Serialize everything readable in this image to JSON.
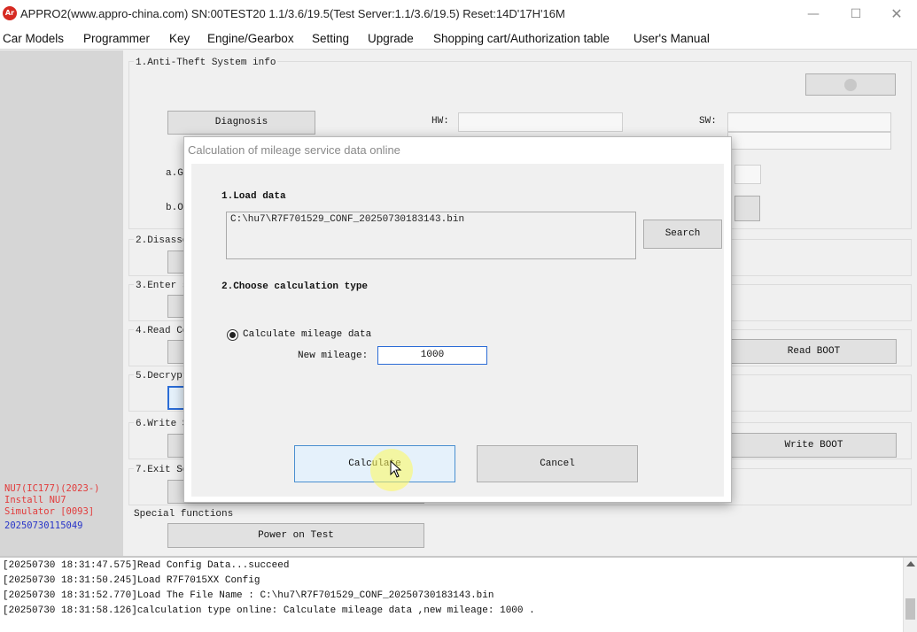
{
  "window": {
    "logo_text": "Ar",
    "title": "APPRO2(www.appro-china.com) SN:00TEST20 1.1/3.6/19.5(Test Server:1.1/3.6/19.5) Reset:14D'17H'16M",
    "minimize": "—",
    "maximize": "☐",
    "close": "✕"
  },
  "menu": [
    "Car Models",
    "Programmer",
    "Key",
    "Engine/Gearbox",
    "Setting",
    "Upgrade",
    "Shopping cart/Authorization table",
    "User's Manual"
  ],
  "side": {
    "line1": "NU7(IC177)(2023-)",
    "line2": "Install NU7",
    "line3": "Simulator [0093]",
    "line4": "20250730115049"
  },
  "main": {
    "sec1": "1.Anti-Theft System info",
    "diagnosis_btn": "Diagnosis",
    "hw_label": "HW:",
    "sw_label": "SW:",
    "sub_a": "a.G",
    "sub_b": "b.O",
    "sec2": "2.Disasse",
    "sec3": "3.Enter s",
    "sec4": "4.Read Co",
    "sec5": "5.Decrypt",
    "sec6": "6.Write S",
    "sec7": "7.Exit Se",
    "special": "Special functions",
    "read_boot": "Read BOOT",
    "write_boot": "Write BOOT",
    "power_on": "Power on Test"
  },
  "dialog": {
    "title": "Calculation of mileage service data online",
    "load_heading": "1.Load data",
    "file_path": "C:\\hu7\\R7F701529_CONF_20250730183143.bin",
    "search_btn": "Search",
    "type_heading": "2.Choose calculation type",
    "radio_label": "Calculate mileage data",
    "mileage_label": "New mileage:",
    "mileage_value": "1000",
    "calculate_btn": "Calculate",
    "cancel_btn": "Cancel"
  },
  "log": [
    "[20250730 18:31:47.575]Read Config Data...succeed",
    "[20250730 18:31:50.245]Load R7F7015XX Config",
    "[20250730 18:31:52.770]Load The File Name : C:\\hu7\\R7F701529_CONF_20250730183143.bin",
    "[20250730 18:31:58.126]calculation type online: Calculate mileage data ,new mileage: 1000 ."
  ]
}
